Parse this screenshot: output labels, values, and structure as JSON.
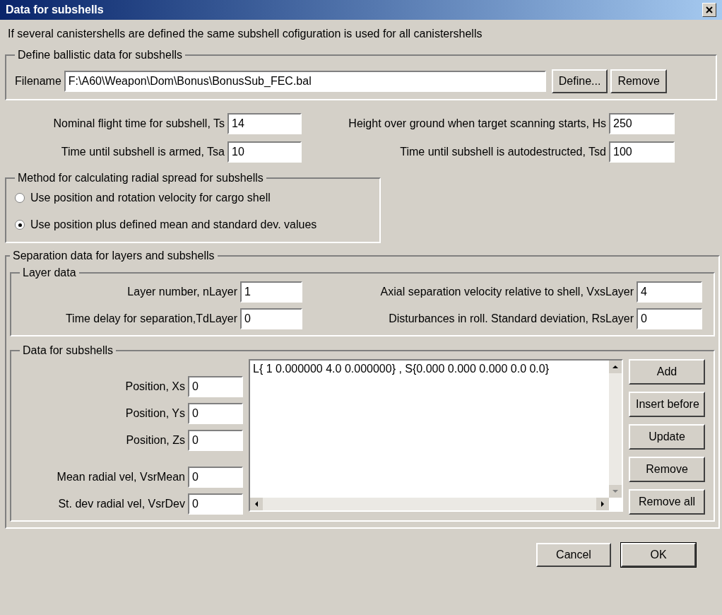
{
  "window": {
    "title": "Data for subshells"
  },
  "info": "If several canistershells are defined the same subshell cofiguration is used for all canistershells",
  "ballistic": {
    "title": "Define ballistic data for subshells",
    "label": "Filename",
    "value": "F:\\A60\\Weapon\\Dom\\Bonus\\BonusSub_FEC.bal",
    "buttons": [
      "Define...",
      "Remove"
    ]
  },
  "timing": [
    {
      "label": "Nominal flight time for subshell, Ts",
      "value": "14"
    },
    {
      "label": "Height over ground when target scanning starts, Hs",
      "value": "250"
    },
    {
      "label": "Time until subshell is armed, Tsa",
      "value": "10"
    },
    {
      "label": "Time until subshell is autodestructed, Tsd",
      "value": "100"
    }
  ],
  "method": {
    "title": "Method for calculating radial spread for subshells",
    "options": [
      {
        "label": "Use position and rotation velocity for cargo shell",
        "selected": false
      },
      {
        "label": "Use position plus defined mean and standard dev. values",
        "selected": true
      }
    ]
  },
  "separation": {
    "title": "Separation data for layers and subshells",
    "layer": {
      "title": "Layer data",
      "fields": [
        {
          "label": "Layer number, nLayer",
          "value": "1"
        },
        {
          "label": "Axial separation velocity relative to shell, VxsLayer",
          "value": "4"
        },
        {
          "label": "Time delay for separation,TdLayer",
          "value": "0"
        },
        {
          "label": "Disturbances in roll. Standard deviation, RsLayer",
          "value": "0"
        }
      ]
    },
    "subshells": {
      "title": "Data for subshells",
      "fields": [
        {
          "label": "Position, Xs",
          "value": "0"
        },
        {
          "label": "Position, Ys",
          "value": "0"
        },
        {
          "label": "Position, Zs",
          "value": "0"
        },
        {
          "label": "Mean radial vel, VsrMean",
          "value": "0"
        },
        {
          "label": "St. dev radial vel, VsrDev",
          "value": "0"
        }
      ],
      "list": [
        "L{ 1 0.000000 4.0 0.000000} , S{0.000 0.000 0.000 0.0 0.0}"
      ],
      "buttons": [
        "Add",
        "Insert before",
        "Update",
        "Remove",
        "Remove all"
      ]
    }
  },
  "footer": {
    "buttons": [
      {
        "label": "Cancel",
        "kind": "normal"
      },
      {
        "label": "OK",
        "kind": "default"
      }
    ]
  }
}
